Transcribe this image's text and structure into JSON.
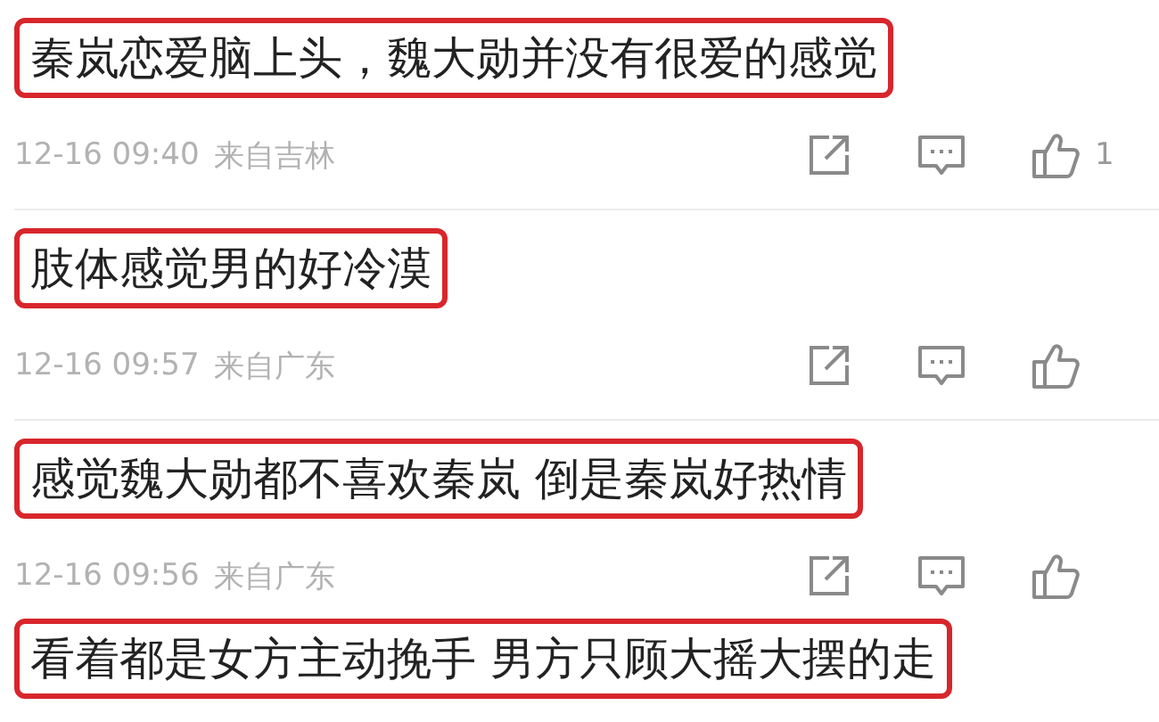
{
  "comments": [
    {
      "text": "秦岚恋爱脑上头，魏大勋并没有很爱的感觉",
      "time": "12-16 09:40",
      "location": "来自吉林",
      "like_count": "1"
    },
    {
      "text": "肢体感觉男的好冷漠",
      "time": "12-16 09:57",
      "location": "来自广东"
    },
    {
      "text": "感觉魏大勋都不喜欢秦岚 倒是秦岚好热情",
      "time": "12-16 09:56",
      "location": "来自广东"
    },
    {
      "text": "看着都是女方主动挽手 男方只顾大摇大摆的走"
    }
  ]
}
